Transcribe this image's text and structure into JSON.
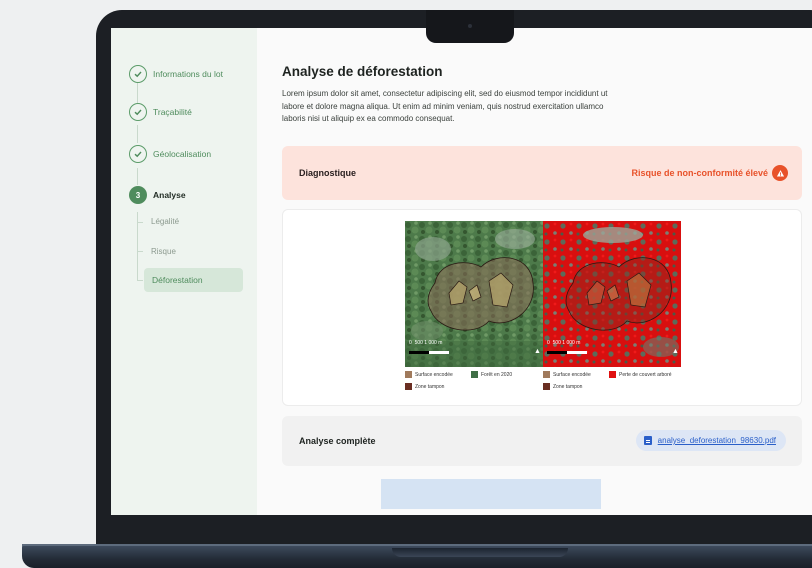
{
  "sidebar": {
    "steps": [
      {
        "label": "Informations du lot"
      },
      {
        "label": "Traçabilité"
      },
      {
        "label": "Géolocalisation"
      },
      {
        "number": "3",
        "label": "Analyse"
      }
    ],
    "sub_items": [
      "Légalité",
      "Risque",
      "Déforestation"
    ]
  },
  "main": {
    "title": "Analyse de déforestation",
    "description": "Lorem ipsum dolor sit amet, consectetur adipiscing elit, sed do eiusmod tempor incididunt ut labore et dolore magna aliqua. Ut enim ad minim veniam, quis nostrud exercitation ullamco laboris nisi ut aliquip ex ea commodo consequat.",
    "diagnostic": {
      "label": "Diagnostique",
      "status": "Risque de non-conformité élevé",
      "icon": "warning-icon"
    },
    "maps": {
      "left": {
        "scale": [
          "0",
          "500",
          "1 000 m"
        ],
        "legend": [
          "Surface encodée",
          "Forêt en 2020",
          "Zone tampon"
        ]
      },
      "right": {
        "scale": [
          "0",
          "500",
          "1 000 m"
        ],
        "legend": [
          "Surface encodée",
          "Perte de couvert arboré",
          "Zone tampon"
        ]
      }
    },
    "full_analysis": {
      "label": "Analyse complète",
      "file": "analyse_deforestation_98630.pdf"
    }
  },
  "colors": {
    "accent": "#4f8c5d",
    "danger": "#e8522a",
    "link": "#2a5fc9",
    "surface": "#a07a5c",
    "forest": "#3f6e45",
    "loss": "#e01010",
    "buffer": "#6a2e22"
  }
}
